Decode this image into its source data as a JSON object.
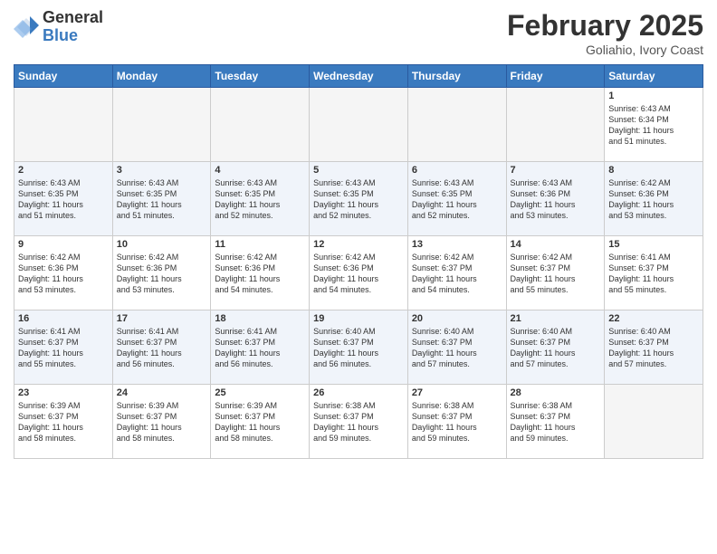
{
  "logo": {
    "general": "General",
    "blue": "Blue"
  },
  "header": {
    "month_year": "February 2025",
    "location": "Goliahio, Ivory Coast"
  },
  "weekdays": [
    "Sunday",
    "Monday",
    "Tuesday",
    "Wednesday",
    "Thursday",
    "Friday",
    "Saturday"
  ],
  "weeks": [
    [
      {
        "day": "",
        "info": ""
      },
      {
        "day": "",
        "info": ""
      },
      {
        "day": "",
        "info": ""
      },
      {
        "day": "",
        "info": ""
      },
      {
        "day": "",
        "info": ""
      },
      {
        "day": "",
        "info": ""
      },
      {
        "day": "1",
        "info": "Sunrise: 6:43 AM\nSunset: 6:34 PM\nDaylight: 11 hours\nand 51 minutes."
      }
    ],
    [
      {
        "day": "2",
        "info": "Sunrise: 6:43 AM\nSunset: 6:35 PM\nDaylight: 11 hours\nand 51 minutes."
      },
      {
        "day": "3",
        "info": "Sunrise: 6:43 AM\nSunset: 6:35 PM\nDaylight: 11 hours\nand 51 minutes."
      },
      {
        "day": "4",
        "info": "Sunrise: 6:43 AM\nSunset: 6:35 PM\nDaylight: 11 hours\nand 52 minutes."
      },
      {
        "day": "5",
        "info": "Sunrise: 6:43 AM\nSunset: 6:35 PM\nDaylight: 11 hours\nand 52 minutes."
      },
      {
        "day": "6",
        "info": "Sunrise: 6:43 AM\nSunset: 6:35 PM\nDaylight: 11 hours\nand 52 minutes."
      },
      {
        "day": "7",
        "info": "Sunrise: 6:43 AM\nSunset: 6:36 PM\nDaylight: 11 hours\nand 53 minutes."
      },
      {
        "day": "8",
        "info": "Sunrise: 6:42 AM\nSunset: 6:36 PM\nDaylight: 11 hours\nand 53 minutes."
      }
    ],
    [
      {
        "day": "9",
        "info": "Sunrise: 6:42 AM\nSunset: 6:36 PM\nDaylight: 11 hours\nand 53 minutes."
      },
      {
        "day": "10",
        "info": "Sunrise: 6:42 AM\nSunset: 6:36 PM\nDaylight: 11 hours\nand 53 minutes."
      },
      {
        "day": "11",
        "info": "Sunrise: 6:42 AM\nSunset: 6:36 PM\nDaylight: 11 hours\nand 54 minutes."
      },
      {
        "day": "12",
        "info": "Sunrise: 6:42 AM\nSunset: 6:36 PM\nDaylight: 11 hours\nand 54 minutes."
      },
      {
        "day": "13",
        "info": "Sunrise: 6:42 AM\nSunset: 6:37 PM\nDaylight: 11 hours\nand 54 minutes."
      },
      {
        "day": "14",
        "info": "Sunrise: 6:42 AM\nSunset: 6:37 PM\nDaylight: 11 hours\nand 55 minutes."
      },
      {
        "day": "15",
        "info": "Sunrise: 6:41 AM\nSunset: 6:37 PM\nDaylight: 11 hours\nand 55 minutes."
      }
    ],
    [
      {
        "day": "16",
        "info": "Sunrise: 6:41 AM\nSunset: 6:37 PM\nDaylight: 11 hours\nand 55 minutes."
      },
      {
        "day": "17",
        "info": "Sunrise: 6:41 AM\nSunset: 6:37 PM\nDaylight: 11 hours\nand 56 minutes."
      },
      {
        "day": "18",
        "info": "Sunrise: 6:41 AM\nSunset: 6:37 PM\nDaylight: 11 hours\nand 56 minutes."
      },
      {
        "day": "19",
        "info": "Sunrise: 6:40 AM\nSunset: 6:37 PM\nDaylight: 11 hours\nand 56 minutes."
      },
      {
        "day": "20",
        "info": "Sunrise: 6:40 AM\nSunset: 6:37 PM\nDaylight: 11 hours\nand 57 minutes."
      },
      {
        "day": "21",
        "info": "Sunrise: 6:40 AM\nSunset: 6:37 PM\nDaylight: 11 hours\nand 57 minutes."
      },
      {
        "day": "22",
        "info": "Sunrise: 6:40 AM\nSunset: 6:37 PM\nDaylight: 11 hours\nand 57 minutes."
      }
    ],
    [
      {
        "day": "23",
        "info": "Sunrise: 6:39 AM\nSunset: 6:37 PM\nDaylight: 11 hours\nand 58 minutes."
      },
      {
        "day": "24",
        "info": "Sunrise: 6:39 AM\nSunset: 6:37 PM\nDaylight: 11 hours\nand 58 minutes."
      },
      {
        "day": "25",
        "info": "Sunrise: 6:39 AM\nSunset: 6:37 PM\nDaylight: 11 hours\nand 58 minutes."
      },
      {
        "day": "26",
        "info": "Sunrise: 6:38 AM\nSunset: 6:37 PM\nDaylight: 11 hours\nand 59 minutes."
      },
      {
        "day": "27",
        "info": "Sunrise: 6:38 AM\nSunset: 6:37 PM\nDaylight: 11 hours\nand 59 minutes."
      },
      {
        "day": "28",
        "info": "Sunrise: 6:38 AM\nSunset: 6:37 PM\nDaylight: 11 hours\nand 59 minutes."
      },
      {
        "day": "",
        "info": ""
      }
    ]
  ],
  "alt_rows": [
    1,
    3
  ]
}
